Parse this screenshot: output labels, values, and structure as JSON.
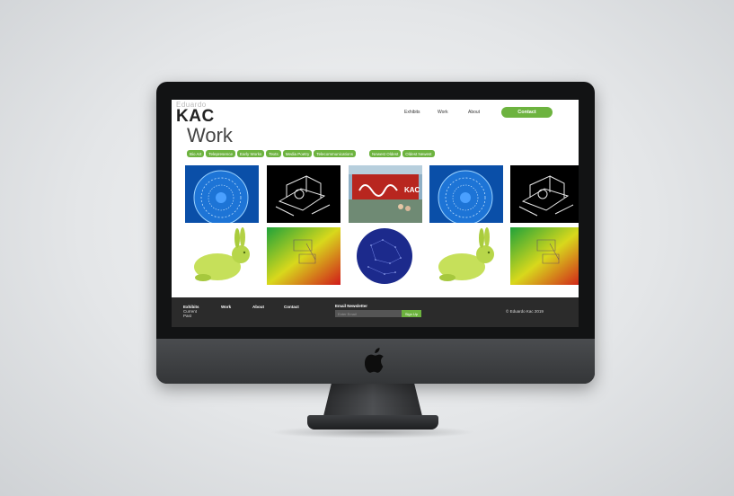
{
  "site": {
    "brand_small": "Eduardo",
    "brand_big": "KAC"
  },
  "nav": {
    "items": [
      "Exhibits",
      "Work",
      "About"
    ],
    "contact": "Contact"
  },
  "page_title": "Work",
  "filters": [
    "Bio Art",
    "Telepresence",
    "Early Works",
    "Texts",
    "Media Poetry",
    "Telecommunications"
  ],
  "sort": [
    "Newest Oldest",
    "Oldest Newest"
  ],
  "tiles": [
    {
      "name": "tile-blue-petri",
      "subject": "blue-petri-dish"
    },
    {
      "name": "tile-robot-line",
      "subject": "robot-line-drawing"
    },
    {
      "name": "tile-kac-mural",
      "subject": "kac-mural-photo"
    },
    {
      "name": "tile-blue-petri-2",
      "subject": "blue-petri-dish"
    },
    {
      "name": "tile-robot-line-2",
      "subject": "robot-line-drawing"
    },
    {
      "name": "tile-glowing-rabbit",
      "subject": "green-rabbit"
    },
    {
      "name": "tile-gradient-art",
      "subject": "gradient-abstract"
    },
    {
      "name": "tile-star-circle",
      "subject": "starfield-circle"
    },
    {
      "name": "tile-glowing-rabbit-2",
      "subject": "green-rabbit"
    },
    {
      "name": "tile-gradient-art-2",
      "subject": "gradient-abstract"
    }
  ],
  "footer": {
    "exhibits": "Exhibits",
    "current": "Current",
    "past": "Past",
    "work": "Work",
    "about": "About",
    "contact": "Contact",
    "newsletter_label": "Email Newsletter",
    "newsletter_placeholder": "Enter Email",
    "newsletter_button": "Sign Up",
    "copyright": "© Eduardo Kac 2019"
  },
  "colors": {
    "accent": "#6db33f",
    "footer_bg": "#2b2b2b"
  }
}
